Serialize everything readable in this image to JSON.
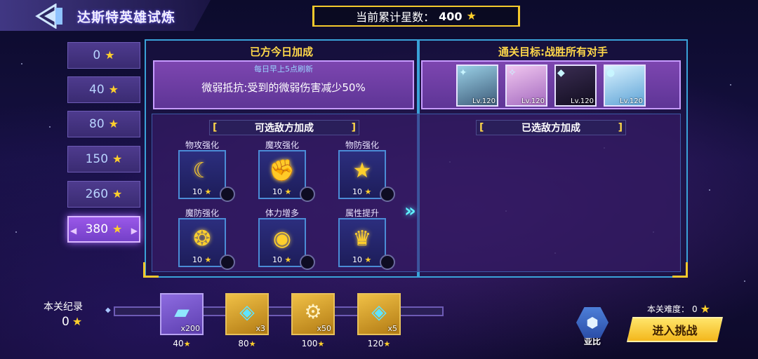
{
  "header": {
    "title": "达斯特英雄试炼",
    "total_stars_label": "当前累计星数：",
    "total_stars_value": "400"
  },
  "tiers": [
    {
      "label": "0"
    },
    {
      "label": "40"
    },
    {
      "label": "80"
    },
    {
      "label": "150"
    },
    {
      "label": "260"
    },
    {
      "label": "380"
    }
  ],
  "active_tier_index": 5,
  "our_buff": {
    "heading": "已方今日加成",
    "refresh_note": "每日早上5点刷新",
    "text": "微弱抵抗:受到的微弱伤害减少50%"
  },
  "goal": {
    "heading": "通关目标:战胜所有对手",
    "opponents": [
      {
        "level": "Lv.120",
        "tag_icon": "sword-icon"
      },
      {
        "level": "Lv.120",
        "tag_icon": "bow-icon"
      },
      {
        "level": "Lv.120",
        "tag_icon": "mask-icon"
      },
      {
        "level": "Lv.120",
        "tag_icon": "orb-icon"
      }
    ]
  },
  "enemy_buffs": {
    "heading": "可选敌方加成",
    "items": [
      {
        "label": "物攻强化",
        "cost": "10",
        "icon": "moon-star-icon"
      },
      {
        "label": "魔攻强化",
        "cost": "10",
        "icon": "arm-icon"
      },
      {
        "label": "物防强化",
        "cost": "10",
        "icon": "star-icon"
      },
      {
        "label": "魔防强化",
        "cost": "10",
        "icon": "crest-icon"
      },
      {
        "label": "体力增多",
        "cost": "10",
        "icon": "eye-icon"
      },
      {
        "label": "属性提升",
        "cost": "10",
        "icon": "helmet-icon"
      }
    ]
  },
  "selected_buffs": {
    "heading": "已选敌方加成"
  },
  "record": {
    "label": "本关纪录",
    "value": "0"
  },
  "rewards": [
    {
      "count": "x200",
      "req": "40",
      "icon": "card-icon"
    },
    {
      "count": "x3",
      "req": "80",
      "icon": "crystal-icon"
    },
    {
      "count": "x50",
      "req": "100",
      "icon": "gear-icon"
    },
    {
      "count": "x5",
      "req": "120",
      "icon": "crystal-icon"
    }
  ],
  "record_progress": 0,
  "ally": {
    "label": "亚比"
  },
  "difficulty": {
    "label": "本关难度：",
    "value": "0"
  },
  "enter_button": "进入挑战",
  "colors": {
    "accent_gold": "#ffcf2c",
    "frame_blue": "#3aa2d8",
    "panel_purple": "#7d46b0",
    "cyan_arrow": "#5ff3ff"
  }
}
